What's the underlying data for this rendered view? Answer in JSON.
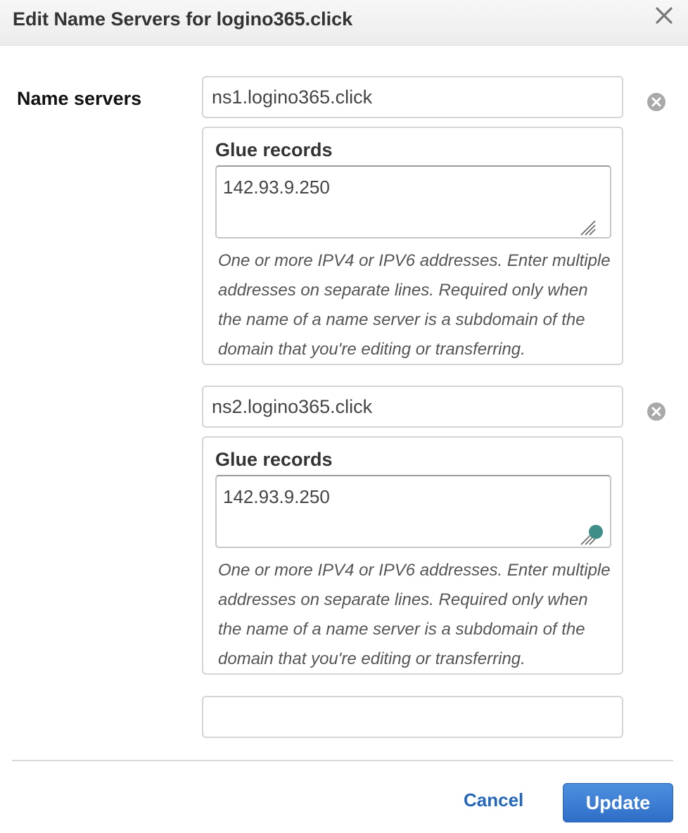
{
  "dialog": {
    "title": "Edit Name Servers for logino365.click",
    "close_icon": "close-icon"
  },
  "form": {
    "name_servers_label": "Name servers",
    "entries": [
      {
        "name_server": "ns1.logino365.click",
        "glue_label": "Glue records",
        "glue_value": "142.93.9.250",
        "help_text": "One or more IPV4 or IPV6 addresses. Enter multiple addresses on separate lines. Required only when the name of a name server is a subdomain of the domain that you're editing or transferring."
      },
      {
        "name_server": "ns2.logino365.click",
        "glue_label": "Glue records",
        "glue_value": "142.93.9.250",
        "help_text": "One or more IPV4 or IPV6 addresses. Enter multiple addresses on separate lines. Required only when the name of a name server is a subdomain of the domain that you're editing or transferring."
      }
    ],
    "empty_name_server": ""
  },
  "footer": {
    "cancel_label": "Cancel",
    "update_label": "Update"
  },
  "colors": {
    "primary_button": "#2f6ec8",
    "link": "#2567b9",
    "focus_indicator": "#3f8f88"
  }
}
